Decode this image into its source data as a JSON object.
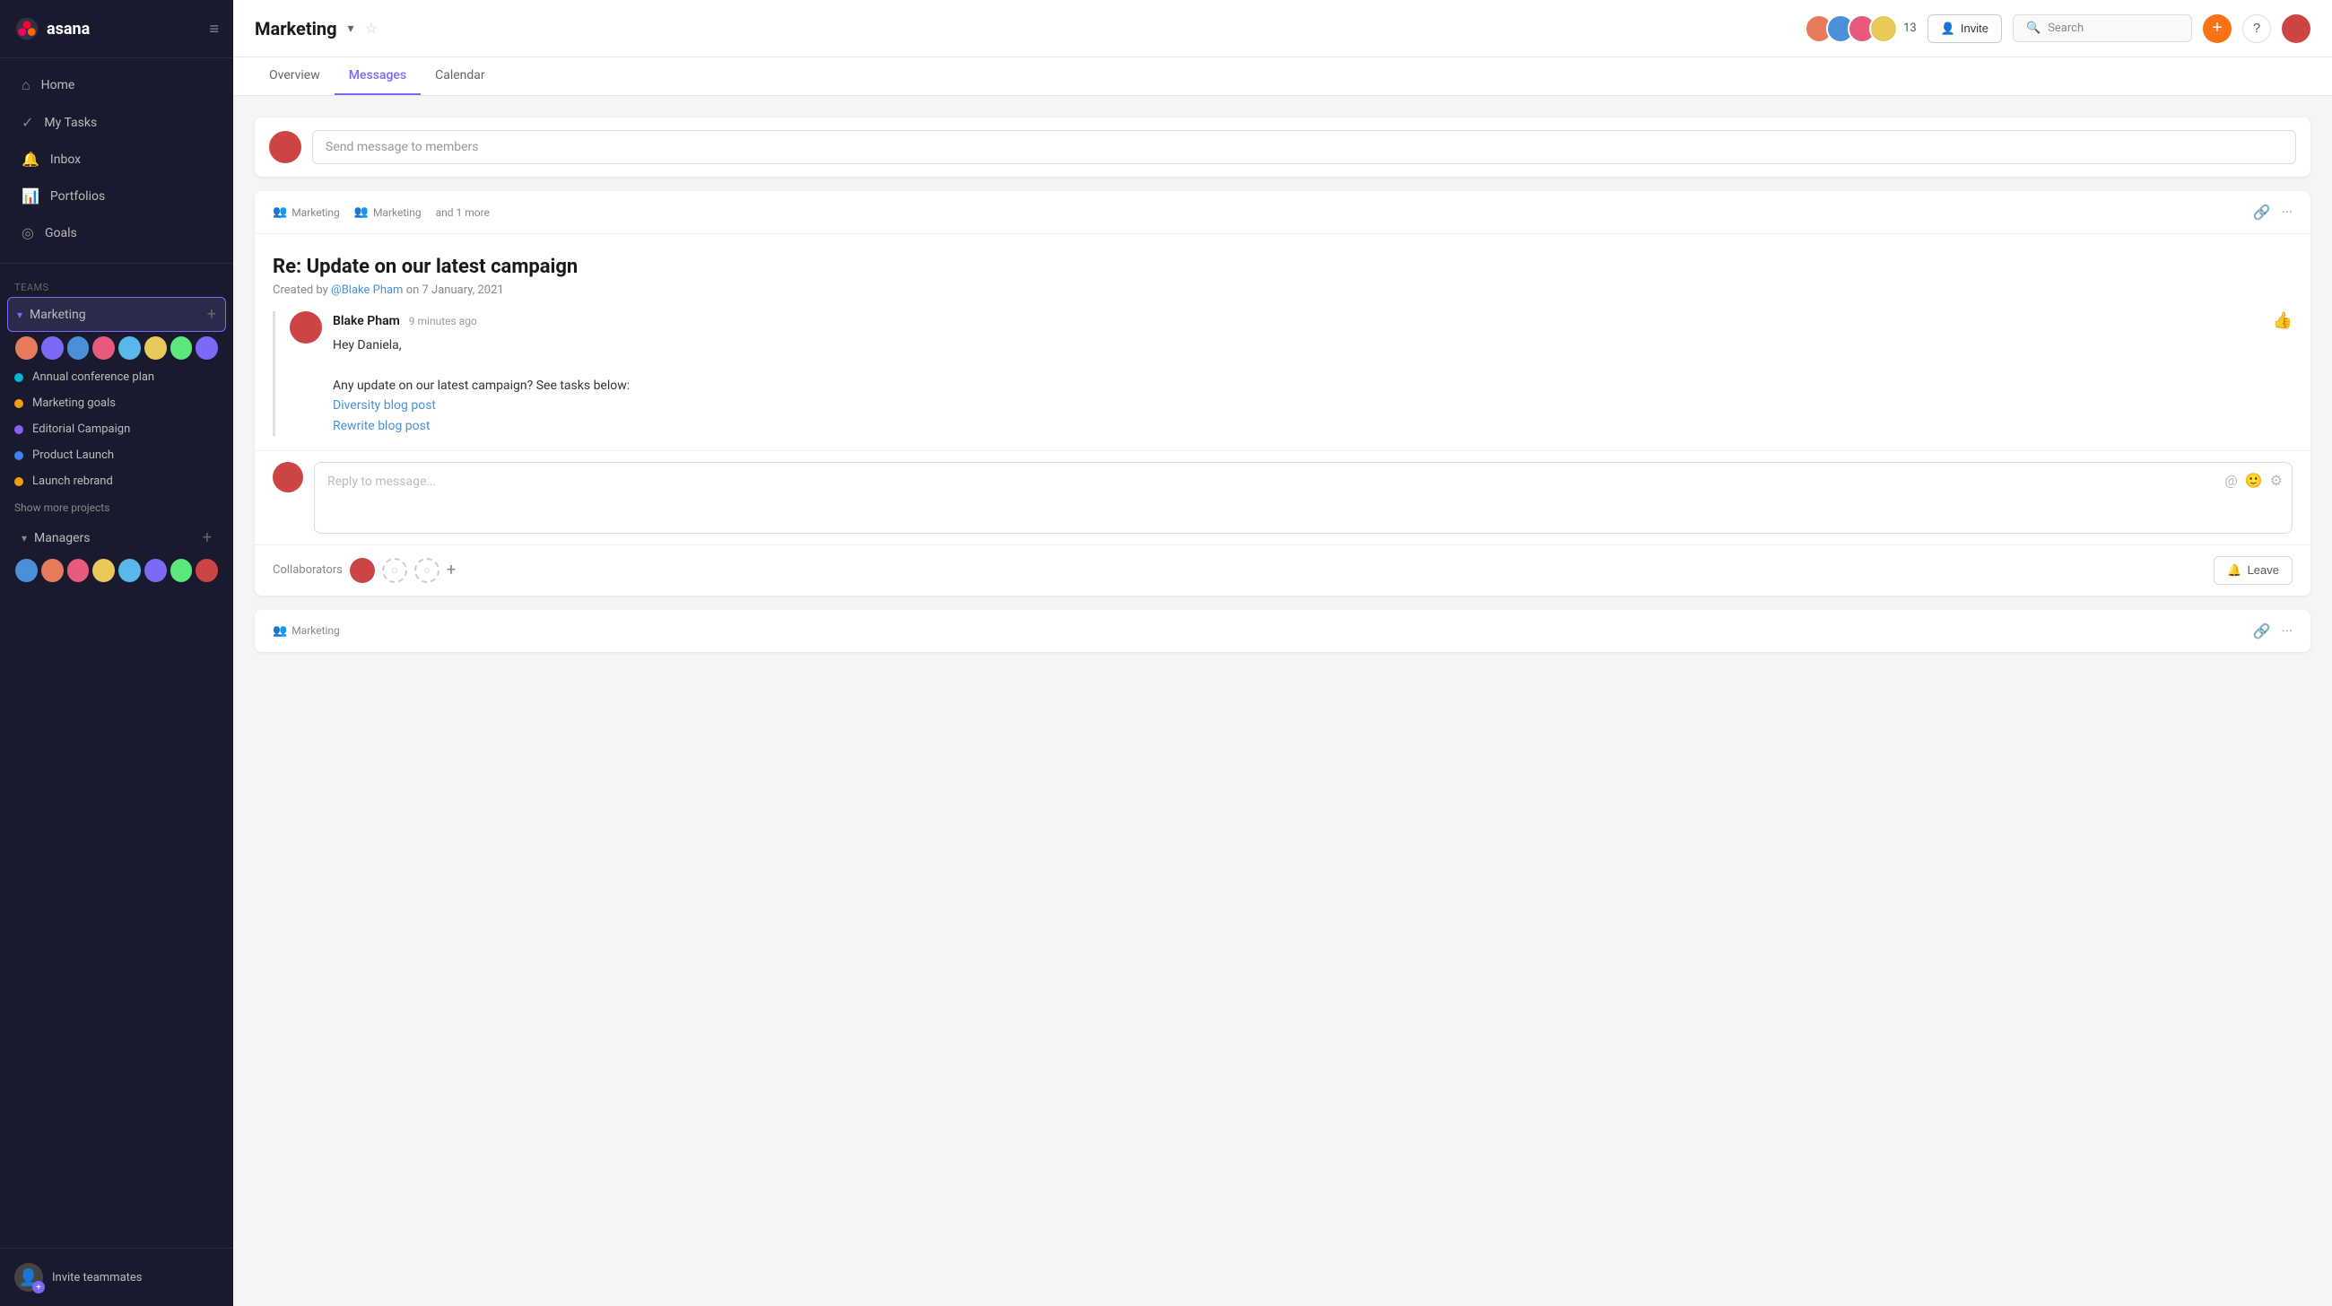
{
  "app": {
    "name": "asana",
    "logo_text": "asana"
  },
  "sidebar": {
    "nav": [
      {
        "id": "home",
        "label": "Home",
        "icon": "⌂"
      },
      {
        "id": "my-tasks",
        "label": "My Tasks",
        "icon": "✓"
      },
      {
        "id": "inbox",
        "label": "Inbox",
        "icon": "🔔"
      },
      {
        "id": "portfolios",
        "label": "Portfolios",
        "icon": "📊"
      },
      {
        "id": "goals",
        "label": "Goals",
        "icon": "◎"
      }
    ],
    "teams_label": "Teams",
    "teams": [
      {
        "id": "marketing",
        "label": "Marketing",
        "active": true,
        "projects": [
          {
            "id": "annual",
            "label": "Annual conference plan",
            "color": "teal"
          },
          {
            "id": "marketing-goals",
            "label": "Marketing goals",
            "color": "yellow"
          },
          {
            "id": "editorial",
            "label": "Editorial Campaign",
            "color": "purple"
          },
          {
            "id": "product-launch",
            "label": "Product Launch",
            "color": "blue"
          },
          {
            "id": "launch-rebrand",
            "label": "Launch rebrand",
            "color": "yellow"
          }
        ]
      },
      {
        "id": "managers",
        "label": "Managers",
        "active": false,
        "projects": []
      }
    ],
    "show_more": "Show more projects",
    "invite": {
      "label": "Invite teammates",
      "icon": "👤"
    }
  },
  "header": {
    "title": "Marketing",
    "tabs": [
      {
        "id": "overview",
        "label": "Overview",
        "active": false
      },
      {
        "id": "messages",
        "label": "Messages",
        "active": true
      },
      {
        "id": "calendar",
        "label": "Calendar",
        "active": false
      }
    ],
    "member_count": "13",
    "invite_btn": "Invite",
    "search_placeholder": "Search",
    "add_icon": "+",
    "help_icon": "?"
  },
  "messages": {
    "composer_placeholder": "Send message to members",
    "cards": [
      {
        "id": "msg1",
        "meta_teams": [
          "Marketing",
          "Marketing",
          "and 1 more"
        ],
        "title": "Re: Update on our latest campaign",
        "created_by": "@Blake Pham",
        "created_date": "on 7 January, 2021",
        "created_prefix": "Created by",
        "thread": {
          "author": "Blake Pham",
          "time": "9 minutes ago",
          "greeting": "Hey Daniela,",
          "body": "Any update on our latest campaign? See tasks below:",
          "links": [
            {
              "id": "link1",
              "label": "Diversity blog post"
            },
            {
              "id": "link2",
              "label": "Rewrite blog post"
            }
          ]
        },
        "reply_placeholder": "Reply to message...",
        "collaborators_label": "Collaborators",
        "leave_btn": "Leave",
        "leave_icon": "🔔"
      },
      {
        "id": "msg2",
        "meta_teams": [
          "Marketing"
        ],
        "title": ""
      }
    ]
  }
}
